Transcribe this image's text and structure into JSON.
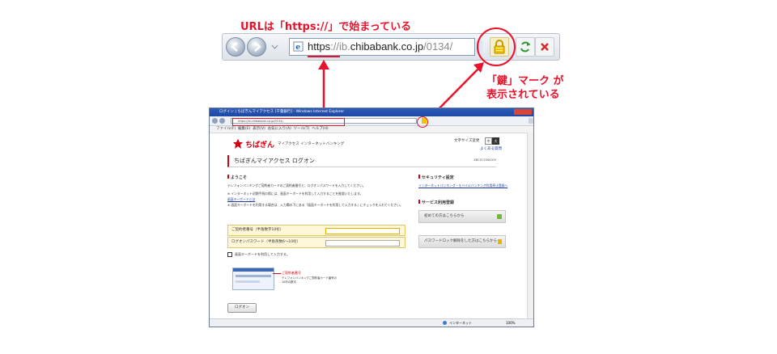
{
  "annotations": {
    "url_note": "URLは「https://」で始まっている",
    "lock_note_line1": "「鍵」マーク が",
    "lock_note_line2": "表示されている"
  },
  "zoom_bar": {
    "url_https": "https",
    "url_sep": "://",
    "url_ib": "ib.",
    "url_domain": "chibabank.co.jp",
    "url_path": "/0134/"
  },
  "browser": {
    "title": "ログイン | ちばぎんマイアクセス [千葉銀行] - Windows Internet Explorer",
    "address": "https://ib.chibabank.co.jp/0134/",
    "menu": [
      "ファイル(F)",
      "編集(E)",
      "表示(V)",
      "お気に入り(A)",
      "ツール(T)",
      "ヘルプ(H)"
    ],
    "status_text": "インターネット",
    "zoom_text": "100%"
  },
  "page": {
    "brand": "ちばぎん",
    "brand_sub": "マイアクセス インターネットバンキング",
    "font_size_label": "文字サイズ変更",
    "font_small": "中",
    "font_large": "大",
    "faq_link": "よくある質問",
    "heading": "ちばぎんマイアクセス ログオン",
    "page_code": "KBC0133N0000",
    "welcome_title": "ようこそ",
    "welcome_text": "テレフォンバンキングご契約者カードのご契約者番号と、ログオンパスワードを入力してください。",
    "note1": "※ インターネット初期手続の際には、画面キーボードを利用して入力することを推奨いたします。",
    "keyboard_link": "画面キーボードとは",
    "note2": "※ 画面キーボードを利用する場合は、入力欄の下にある「画面キーボードを利用して入力する」にチェックを入れてください。",
    "field_account": "ご契約者番号（半角数字10桁）",
    "field_password": "ログオンパスワード（半角英数6〜10桁）",
    "checkbox_label": "画面キーボードを利用して入力する。",
    "card_caption1": "ご契約者番号",
    "card_caption2": "テレフォンバンキングご契約者カード番号の",
    "card_caption3": "10桁の数字",
    "logon_button": "ログオン",
    "security_title": "セキュリティ設定",
    "security_link": "インターネットバンキング・モバイルバンキング利用停止登録へ",
    "service_title": "サービス利用登録",
    "first_time_button": "初めての方はこちらから",
    "password_lock_button": "パスワードロック解除をした方はこちらから"
  },
  "colors": {
    "accent_red": "#e8132b",
    "brand_red": "#d7000f",
    "lock_gold": "#e5b500"
  }
}
